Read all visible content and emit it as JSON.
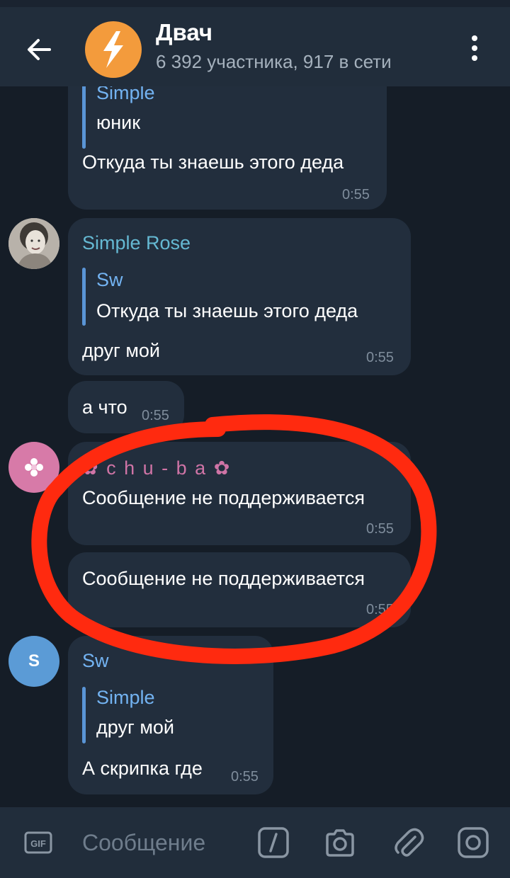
{
  "header": {
    "title": "Двач",
    "subtitle": "6 392 участника, 917 в сети"
  },
  "messages": [
    {
      "reply_name": "Simple",
      "reply_text": "юник",
      "text": "Откуда ты знаешь этого деда",
      "time": "0:55"
    },
    {
      "sender": "Simple Rose",
      "reply_name": "Sw",
      "reply_text": "Откуда ты знаешь этого деда",
      "text": "друг мой",
      "time": "0:55"
    },
    {
      "text": "а что",
      "time": "0:55"
    },
    {
      "sender": "✿ c h u - b a ✿",
      "text": "Сообщение не поддерживается",
      "time": "0:55"
    },
    {
      "text": "Сообщение не поддерживается",
      "time": "0:55"
    },
    {
      "sender": "Sw",
      "avatar_letter": "S",
      "reply_name": "Simple",
      "reply_text": "друг мой",
      "text": "А скрипка где",
      "time": "0:55"
    }
  ],
  "input": {
    "placeholder": "Сообщение"
  },
  "icons": [
    "back-arrow-icon",
    "lightning-icon",
    "more-vert-icon",
    "gif-icon",
    "slash-command-icon",
    "camera-icon",
    "paperclip-icon",
    "sticker-icon"
  ],
  "colors": {
    "background": "#151d27",
    "header": "#212d3b",
    "bubble": "#222e3d",
    "accent_blue": "#73b3f2",
    "sender_teal": "#65b9d3",
    "sender_pink": "#cf74a6",
    "annotation_red": "#ff2a0f"
  }
}
